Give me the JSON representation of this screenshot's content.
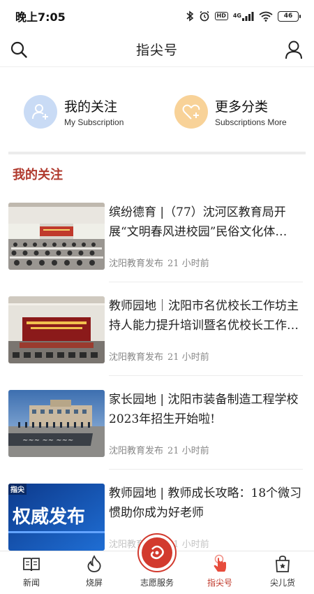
{
  "status_bar": {
    "time": "晚上7:05",
    "battery": "46",
    "network": "4G"
  },
  "top_nav": {
    "title": "指尖号",
    "search_icon": "search-icon",
    "user_icon": "user-icon"
  },
  "shortcuts": [
    {
      "title": "我的关注",
      "subtitle": "My Subscription",
      "icon": "add-person-icon",
      "color": "#c9dbf5"
    },
    {
      "title": "更多分类",
      "subtitle": "Subscriptions More",
      "icon": "heart-plus-icon",
      "color": "#f8d298"
    }
  ],
  "section": {
    "title": "我的关注"
  },
  "news": [
    {
      "title": "缤纷德育 |（77）沈河区教育局开展“文明春风进校园”民俗文化体…",
      "source": "沈阳教育发布",
      "time": "21 小时前",
      "thumb": "conference-hall"
    },
    {
      "title": "教师园地｜沈阳市名优校长工作坊主持人能力提升培训暨名优校长工作…",
      "source": "沈阳教育发布",
      "time": "21 小时前",
      "thumb": "stage-meeting"
    },
    {
      "title": "家长园地 | 沈阳市装备制造工程学校2023年招生开始啦!",
      "source": "沈阳教育发布",
      "time": "21 小时前",
      "thumb": "school-building"
    },
    {
      "title": "教师园地 | 教师成长攻略：18个微习惯助你成为好老师",
      "source": "沈阳教育发布",
      "time": "21 小时前",
      "thumb": "authority-release",
      "thumb_text": "权威发布",
      "thumb_tag": "指尖"
    }
  ],
  "tabs": [
    {
      "label": "新闻",
      "icon": "book-icon",
      "active": false
    },
    {
      "label": "烧屏",
      "icon": "flame-icon",
      "active": false
    },
    {
      "label": "志愿服务",
      "icon": "volunteer-logo-icon",
      "active": false
    },
    {
      "label": "指尖号",
      "icon": "hand-tap-icon",
      "active": true
    },
    {
      "label": "尖儿货",
      "icon": "shopping-bag-icon",
      "active": false
    }
  ],
  "colors": {
    "accent": "#c0392b",
    "section_title": "#b03a2e",
    "meta_text": "#888888"
  }
}
